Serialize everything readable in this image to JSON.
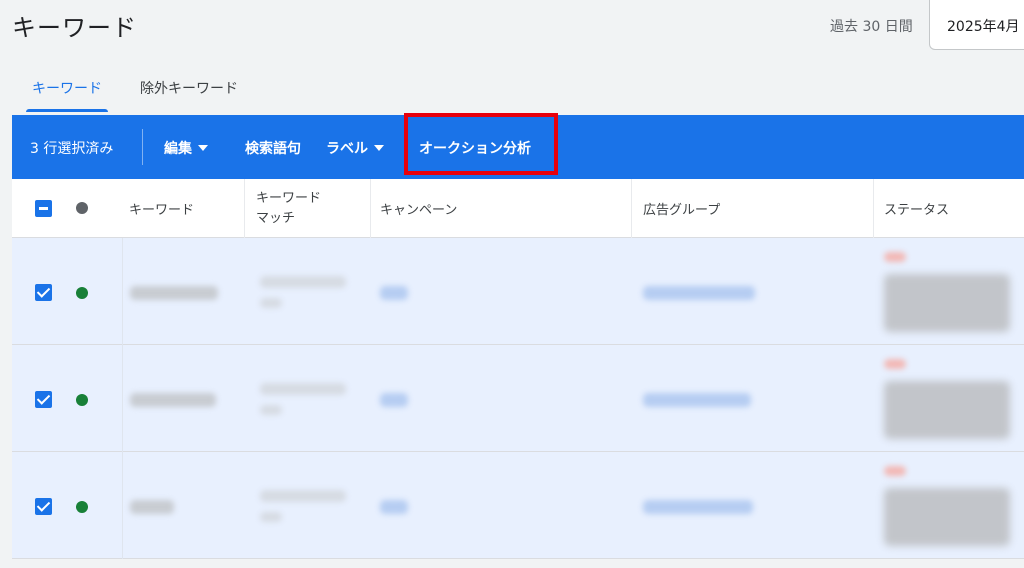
{
  "header": {
    "title": "キーワード",
    "date_range_label": "過去 30 日間",
    "date_value": "2025年4月"
  },
  "tabs": [
    {
      "label": "キーワード",
      "active": true
    },
    {
      "label": "除外キーワード",
      "active": false
    }
  ],
  "action_bar": {
    "selected_text": "3 行選択済み",
    "edit_label": "編集",
    "search_terms_label": "検索語句",
    "label_label": "ラベル",
    "auction_label": "オークション分析"
  },
  "table": {
    "columns": {
      "keyword": "キーワード",
      "match_line1": "キーワード",
      "match_line2": "マッチ",
      "campaign": "キャンペーン",
      "ad_group": "広告グループ",
      "status": "ステータス"
    },
    "rows": [
      {
        "checked": true,
        "status": "enabled"
      },
      {
        "checked": true,
        "status": "enabled"
      },
      {
        "checked": true,
        "status": "enabled"
      }
    ]
  },
  "colors": {
    "accent": "#1a73e8",
    "highlight": "#e8000b",
    "enabled_dot": "#188038",
    "header_dot": "#5f6368",
    "selected_row": "#e8f0fe"
  },
  "icons": {
    "header_checkbox": "indeterminate-checkbox-icon",
    "row_checkbox": "checked-checkbox-icon",
    "dropdown": "caret-down-icon",
    "status": "status-dot-icon"
  }
}
